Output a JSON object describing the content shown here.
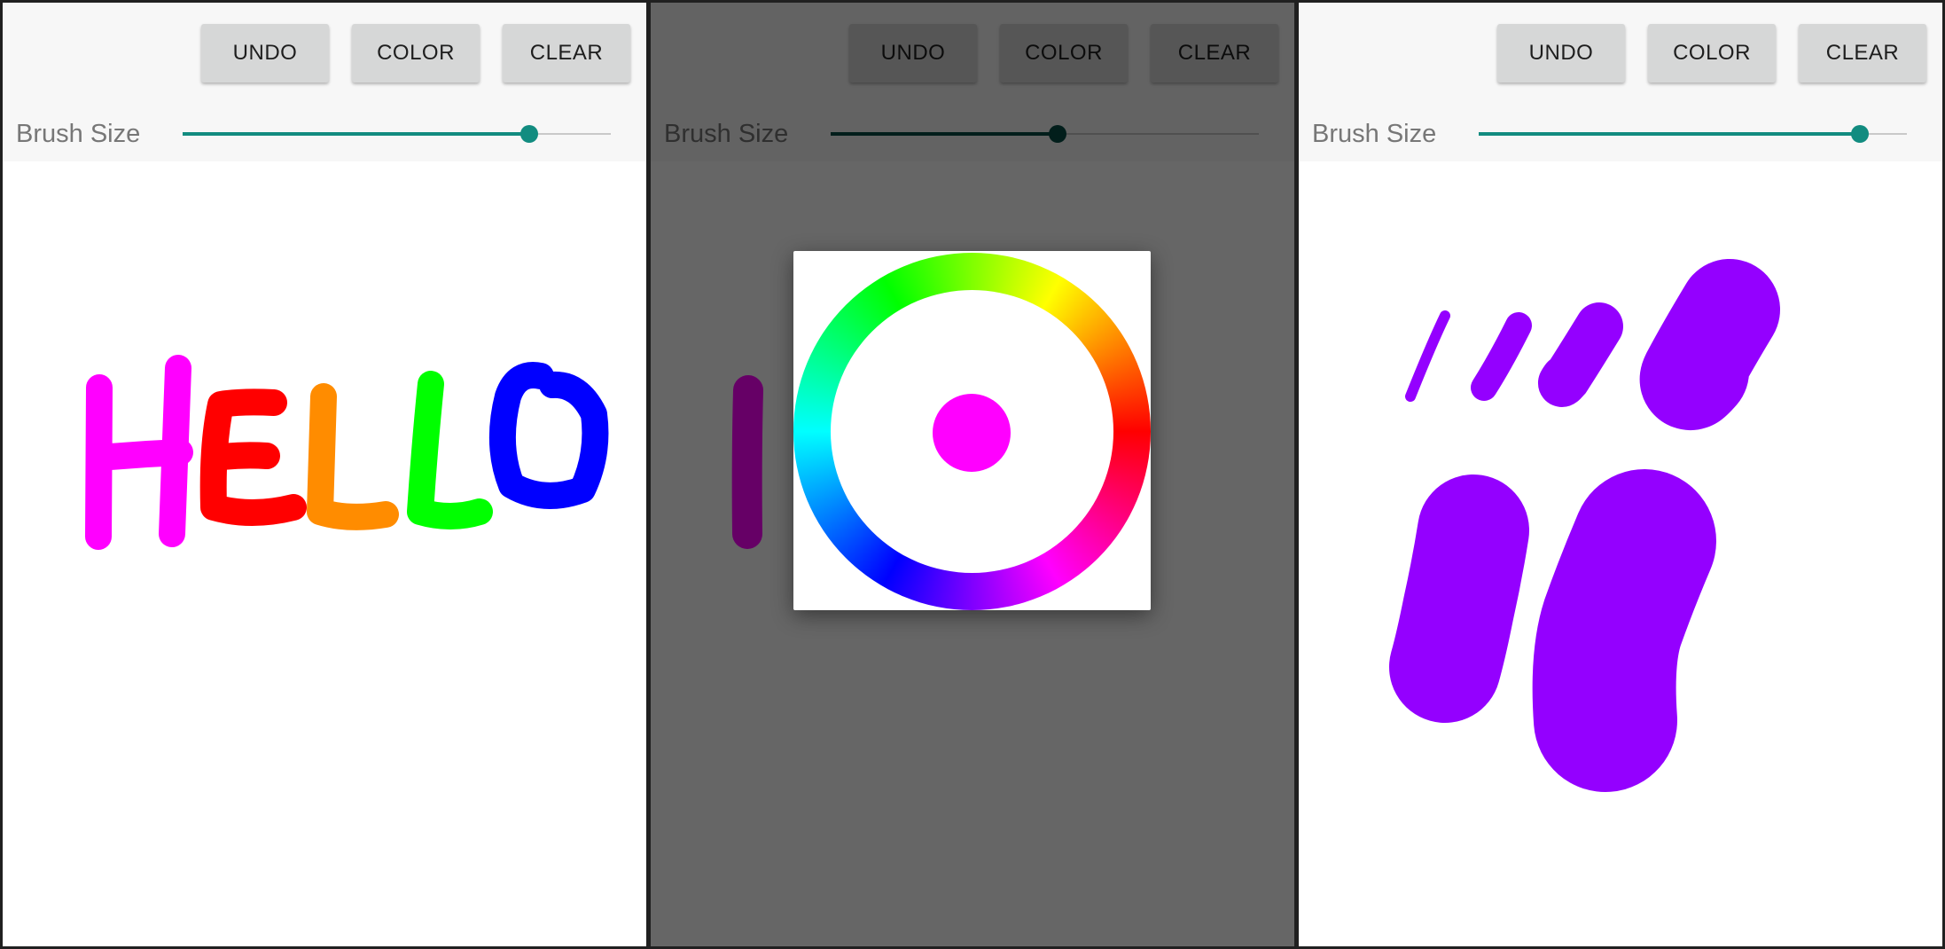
{
  "toolbar": {
    "undo_label": "UNDO",
    "color_label": "COLOR",
    "clear_label": "CLEAR",
    "brush_label": "Brush Size"
  },
  "screens": [
    {
      "brush_size_fraction": 0.81
    },
    {
      "brush_size_fraction": 0.53
    },
    {
      "brush_size_fraction": 0.89
    }
  ],
  "color_picker": {
    "selected_color": "#ff00ff"
  },
  "colors": {
    "accent": "#128c80",
    "accent_dimmed": "#074c45",
    "stroke_pink": "#ff00ff",
    "stroke_red": "#ff0000",
    "stroke_orange": "#ff8c00",
    "stroke_green": "#00ff00",
    "stroke_blue": "#0000ff",
    "stroke_dark_purple": "#6a0068",
    "stroke_violet": "#9400ff"
  }
}
